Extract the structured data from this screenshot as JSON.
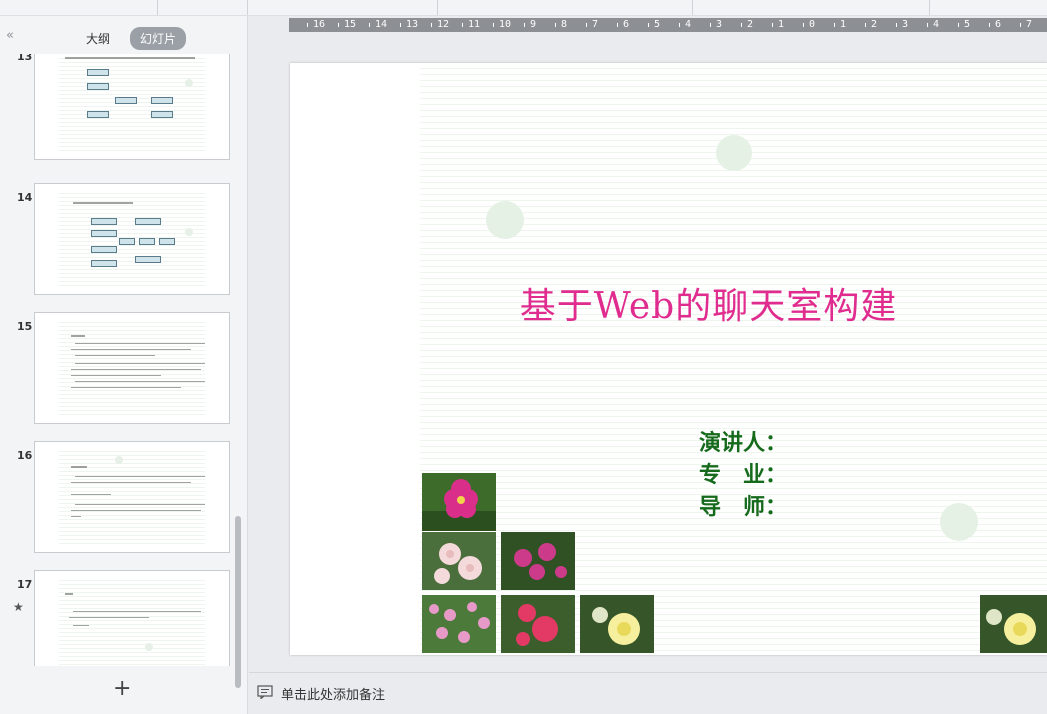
{
  "left_panel": {
    "collapse_glyph": "«",
    "tabs": [
      "大纲",
      "幻灯片"
    ],
    "active_tab": "幻灯片",
    "thumbnails": [
      {
        "number": "13"
      },
      {
        "number": "14"
      },
      {
        "number": "15"
      },
      {
        "number": "16"
      },
      {
        "number": "17",
        "starred": true
      }
    ],
    "add_slide_glyph": "+"
  },
  "ruler": {
    "labels": [
      "16",
      "15",
      "14",
      "13",
      "12",
      "11",
      "10",
      "9",
      "8",
      "7",
      "6",
      "5",
      "4",
      "3",
      "2",
      "1",
      "0",
      "1",
      "2",
      "3",
      "4",
      "5",
      "6",
      "7"
    ]
  },
  "slide": {
    "title": "基于Web的聊天室构建",
    "speaker_label": "演讲人：",
    "major_label": "专　业：",
    "advisor_label": "导　师：",
    "title_color": "#e02c8e",
    "info_color": "#156b1b"
  },
  "notes": {
    "placeholder": "单击此处添加备注"
  }
}
